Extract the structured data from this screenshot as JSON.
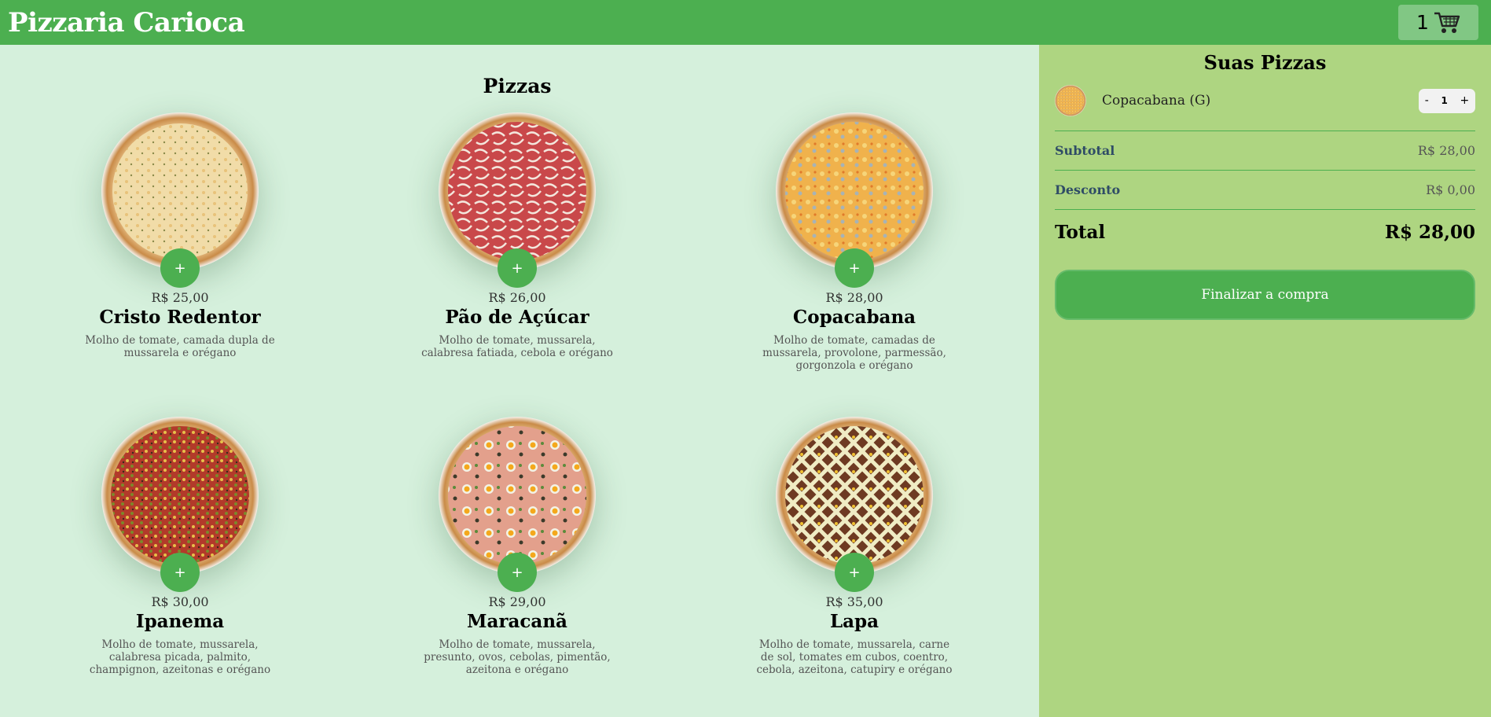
{
  "header": {
    "brand": "Pizzaria Carioca",
    "cart_count": "1",
    "cart_icon": "cart-icon"
  },
  "menu": {
    "title": "Pizzas",
    "add_label": "+",
    "pizzas": [
      {
        "name": "Cristo Redentor",
        "price": "R$ 25,00",
        "description": "Molho de tomate, camada dupla de mussarela e orégano"
      },
      {
        "name": "Pão de Açúcar",
        "price": "R$ 26,00",
        "description": "Molho de tomate, mussarela, calabresa fatiada, cebola e orégano"
      },
      {
        "name": "Copacabana",
        "price": "R$ 28,00",
        "description": "Molho de tomate, camadas de mussarela, provolone, parmessão, gorgonzola e orégano"
      },
      {
        "name": "Ipanema",
        "price": "R$ 30,00",
        "description": "Molho de tomate, mussarela, calabresa picada, palmito, champignon, azeitonas e orégano"
      },
      {
        "name": "Maracanã",
        "price": "R$ 29,00",
        "description": "Molho de tomate, mussarela, presunto, ovos, cebolas, pimentão, azeitona e orégano"
      },
      {
        "name": "Lapa",
        "price": "R$ 35,00",
        "description": "Molho de tomate, mussarela, carne de sol, tomates em cubos, coentro, cebola, azeitona, catupiry e orégano"
      }
    ]
  },
  "cart": {
    "title": "Suas Pizzas",
    "items": [
      {
        "name": "Copacabana (G)",
        "qty": "1",
        "minus": "-",
        "plus": "+"
      }
    ],
    "subtotal_label": "Subtotal",
    "subtotal_value": "R$ 28,00",
    "discount_label": "Desconto",
    "discount_value": "R$ 0,00",
    "total_label": "Total",
    "total_value": "R$ 28,00",
    "checkout_label": "Finalizar a compra"
  },
  "colors": {
    "accent": "#4caf50",
    "background": "#d5f0dc",
    "aside": "#aed581"
  }
}
